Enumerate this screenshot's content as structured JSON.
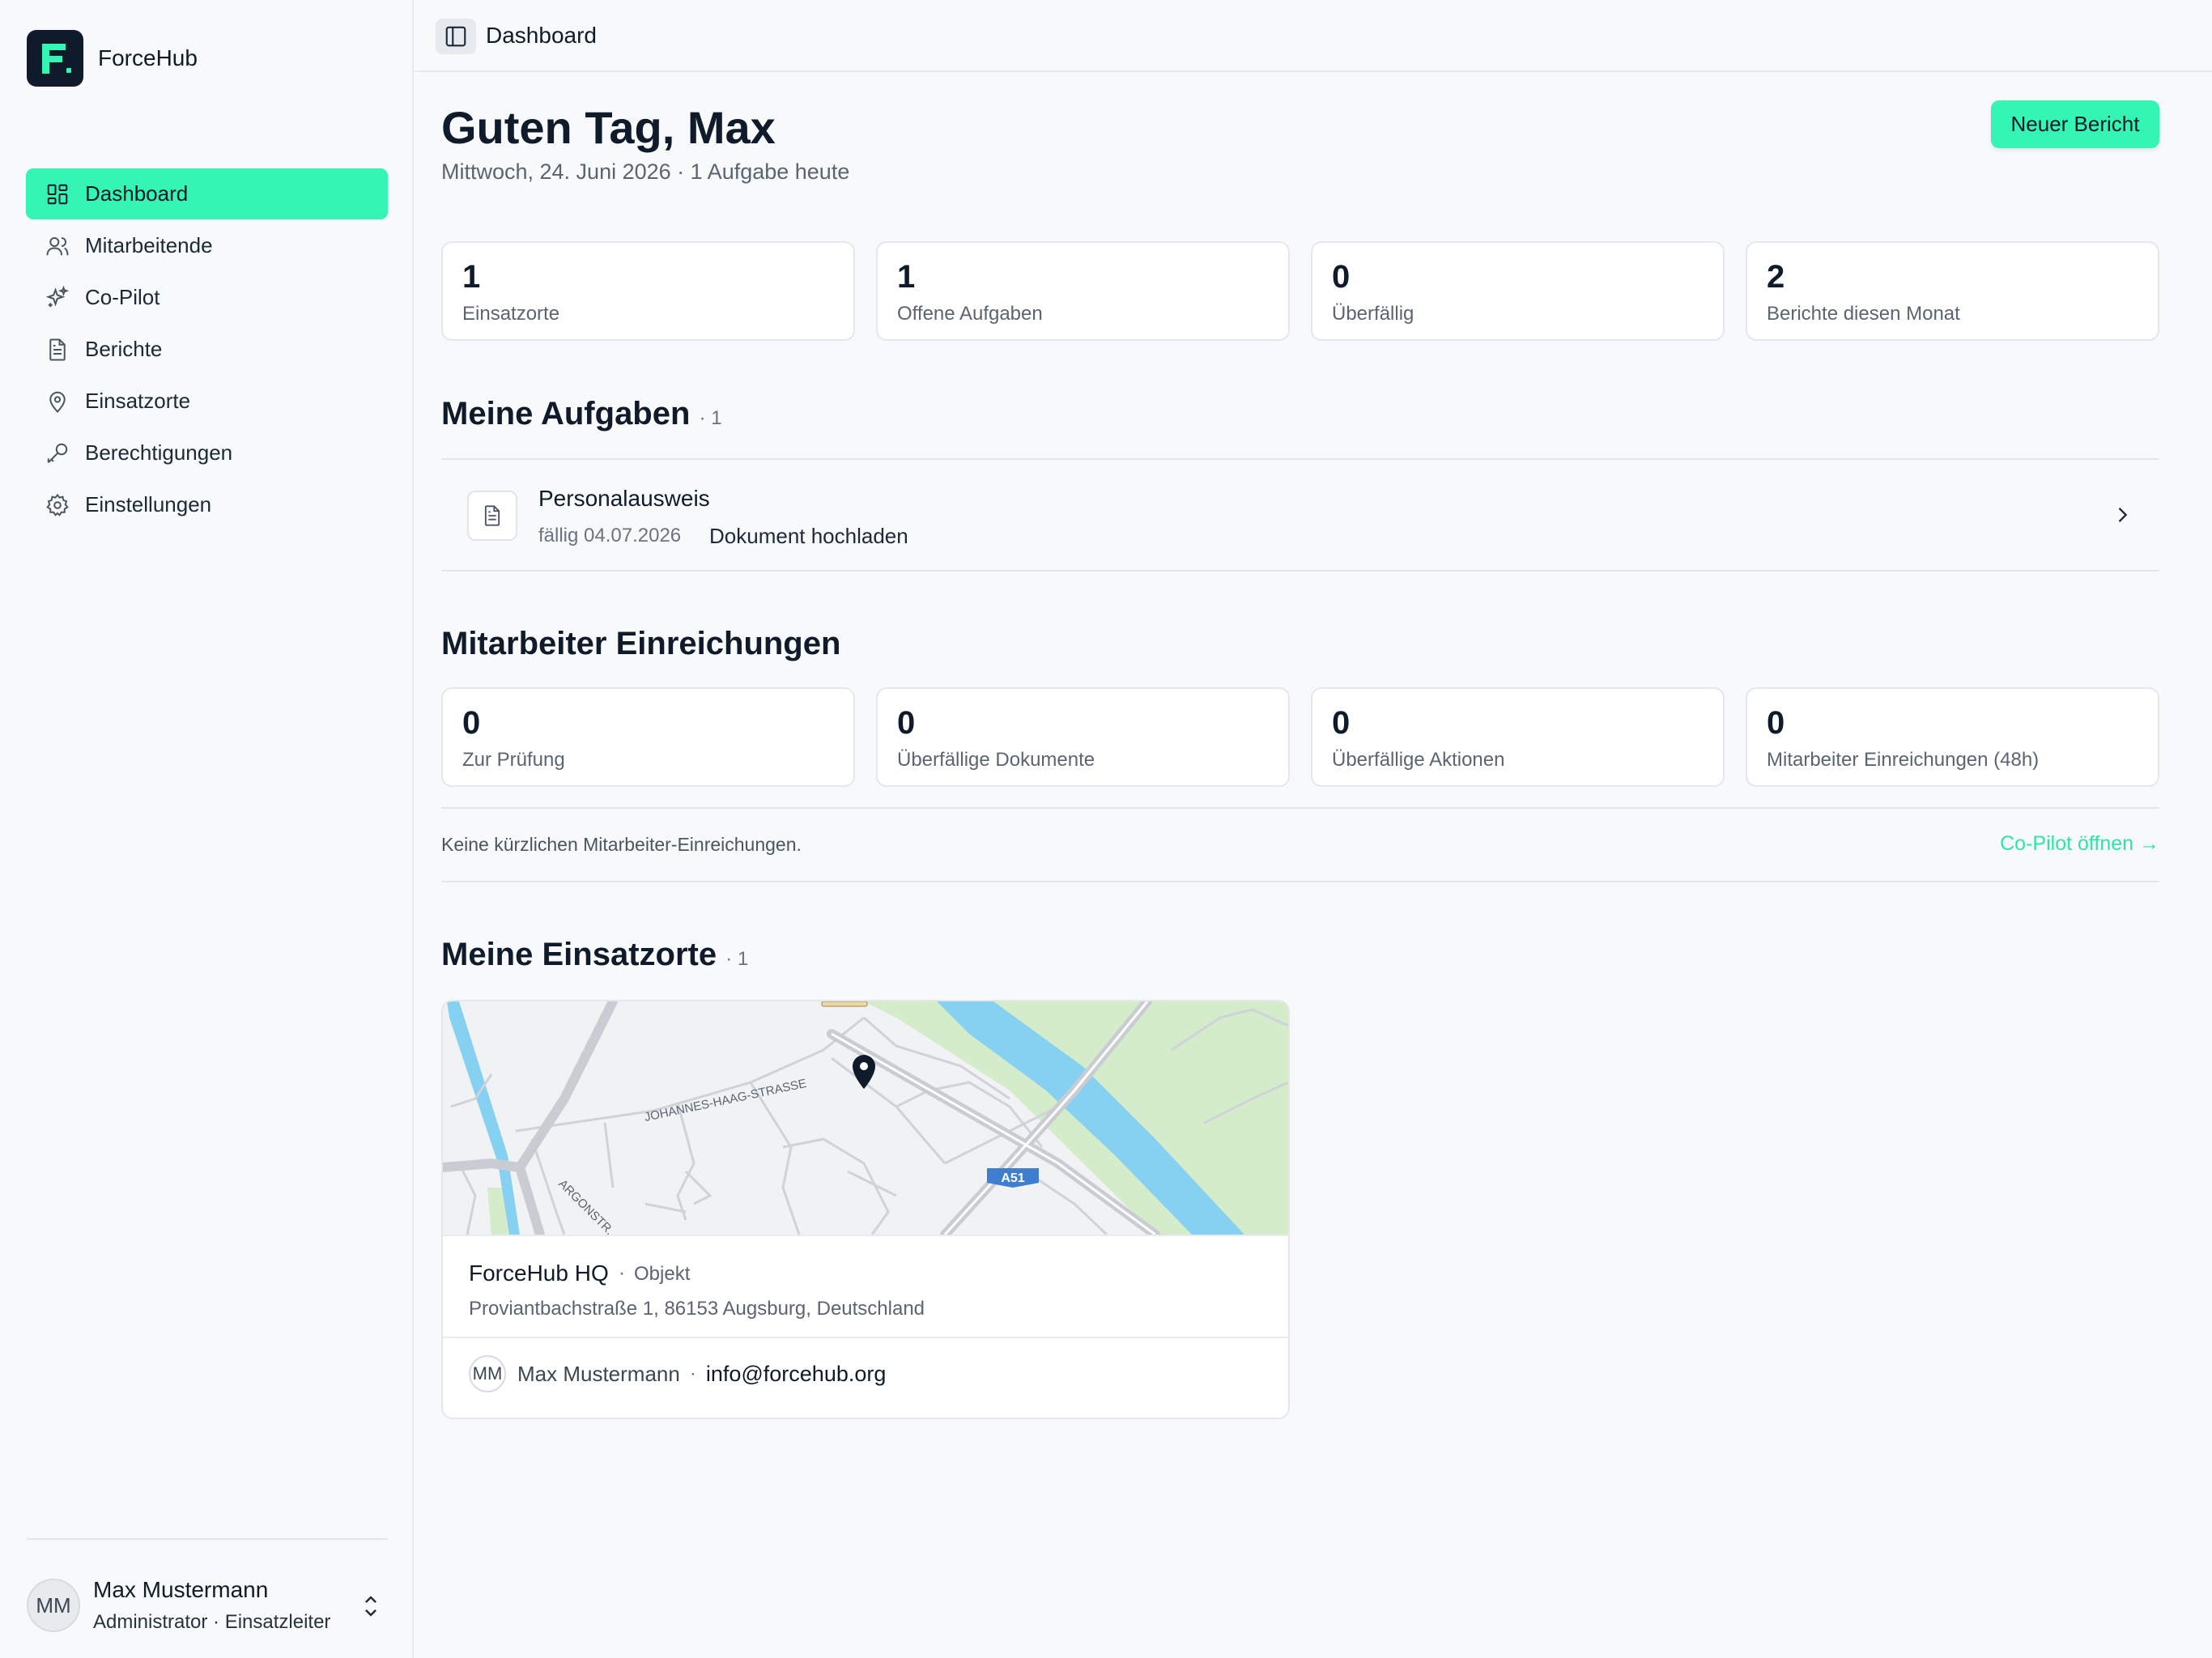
{
  "app": {
    "name": "ForceHub"
  },
  "sidebar": {
    "items": [
      {
        "label": "Dashboard",
        "icon": "dashboard-icon",
        "active": true
      },
      {
        "label": "Mitarbeitende",
        "icon": "users-icon"
      },
      {
        "label": "Co-Pilot",
        "icon": "sparkles-icon"
      },
      {
        "label": "Berichte",
        "icon": "document-icon"
      },
      {
        "label": "Einsatzorte",
        "icon": "map-pin-icon"
      },
      {
        "label": "Berechtigungen",
        "icon": "key-icon"
      },
      {
        "label": "Einstellungen",
        "icon": "gear-icon"
      }
    ],
    "user": {
      "initials": "MM",
      "name": "Max Mustermann",
      "role": "Administrator · Einsatzleiter"
    }
  },
  "topbar": {
    "title": "Dashboard"
  },
  "main": {
    "greeting": "Guten Tag, Max",
    "subline": "Mittwoch, 24. Juni 2026 · 1 Aufgabe heute",
    "new_report_button": "Neuer Bericht",
    "stats": [
      {
        "value": "1",
        "label": "Einsatzorte"
      },
      {
        "value": "1",
        "label": "Offene Aufgaben"
      },
      {
        "value": "0",
        "label": "Überfällig"
      },
      {
        "value": "2",
        "label": "Berichte diesen Monat"
      }
    ],
    "tasks": {
      "title": "Meine Aufgaben",
      "count": "· 1",
      "items": [
        {
          "title": "Personalausweis",
          "due": "fällig 04.07.2026",
          "action": "Dokument hochladen"
        }
      ]
    },
    "submissions": {
      "title": "Mitarbeiter Einreichungen",
      "stats": [
        {
          "value": "0",
          "label": "Zur Prüfung"
        },
        {
          "value": "0",
          "label": "Überfällige Dokumente"
        },
        {
          "value": "0",
          "label": "Überfällige Aktionen"
        },
        {
          "value": "0",
          "label": "Mitarbeiter Einreichungen (48h)"
        }
      ],
      "empty_text": "Keine kürzlichen Mitarbeiter-Einreichungen.",
      "copilot_link": "Co-Pilot öffnen →"
    },
    "sites": {
      "title": "Meine Einsatzorte",
      "count": "· 1",
      "items": [
        {
          "name": "ForceHub HQ",
          "separator": "·",
          "type": "Objekt",
          "address": "Proviantbachstraße 1, 86153 Augsburg, Deutschland",
          "contact_initials": "MM",
          "contact_name": "Max Mustermann",
          "contact_separator": "·",
          "contact_email": "info@forcehub.org",
          "map": {
            "street_labels": [
              "JOHANNES-HAAG-STRASSE",
              "ARGONSTR."
            ],
            "road_shield": "A51"
          }
        }
      ]
    }
  },
  "colors": {
    "accent": "#34f5b4",
    "accent_link": "#2fe4a6",
    "brand_dark": "#0f1b2a",
    "background": "#f8f9fb",
    "map_water": "#86d0f2",
    "map_park": "#d4ecc9",
    "map_road": "#c9ccd3"
  }
}
